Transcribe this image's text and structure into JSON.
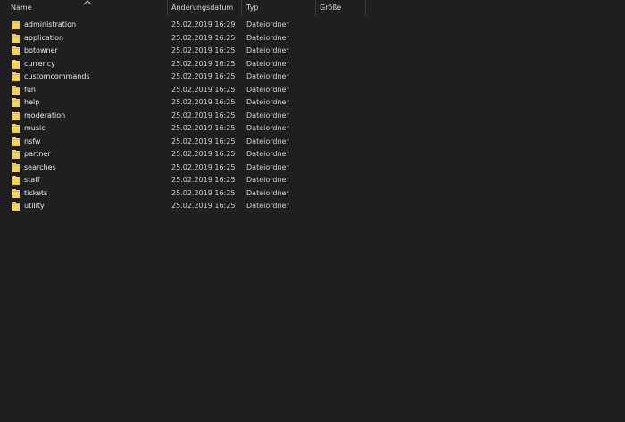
{
  "columns": {
    "name": "Name",
    "date": "Änderungsdatum",
    "type": "Typ",
    "size": "Größe"
  },
  "sort": {
    "column": "name",
    "direction": "ascending",
    "icon": "chevron-up-icon"
  },
  "colors": {
    "background": "#1f1f1f",
    "folder": "#f3d061",
    "text": "#e8e8e8"
  },
  "files": [
    {
      "name": "administration",
      "date": "25.02.2019 16:29",
      "type": "Dateiordner",
      "size": "",
      "icon": "folder-icon"
    },
    {
      "name": "application",
      "date": "25.02.2019 16:25",
      "type": "Dateiordner",
      "size": "",
      "icon": "folder-icon"
    },
    {
      "name": "botowner",
      "date": "25.02.2019 16:25",
      "type": "Dateiordner",
      "size": "",
      "icon": "folder-icon"
    },
    {
      "name": "currency",
      "date": "25.02.2019 16:25",
      "type": "Dateiordner",
      "size": "",
      "icon": "folder-icon"
    },
    {
      "name": "customcommands",
      "date": "25.02.2019 16:25",
      "type": "Dateiordner",
      "size": "",
      "icon": "folder-icon"
    },
    {
      "name": "fun",
      "date": "25.02.2019 16:25",
      "type": "Dateiordner",
      "size": "",
      "icon": "folder-icon"
    },
    {
      "name": "help",
      "date": "25.02.2019 16:25",
      "type": "Dateiordner",
      "size": "",
      "icon": "folder-icon"
    },
    {
      "name": "moderation",
      "date": "25.02.2019 16:25",
      "type": "Dateiordner",
      "size": "",
      "icon": "folder-icon"
    },
    {
      "name": "music",
      "date": "25.02.2019 16:25",
      "type": "Dateiordner",
      "size": "",
      "icon": "folder-icon"
    },
    {
      "name": "nsfw",
      "date": "25.02.2019 16:25",
      "type": "Dateiordner",
      "size": "",
      "icon": "folder-icon"
    },
    {
      "name": "partner",
      "date": "25.02.2019 16:25",
      "type": "Dateiordner",
      "size": "",
      "icon": "folder-icon"
    },
    {
      "name": "searches",
      "date": "25.02.2019 16:25",
      "type": "Dateiordner",
      "size": "",
      "icon": "folder-icon"
    },
    {
      "name": "staff",
      "date": "25.02.2019 16:25",
      "type": "Dateiordner",
      "size": "",
      "icon": "folder-icon"
    },
    {
      "name": "tickets",
      "date": "25.02.2019 16:25",
      "type": "Dateiordner",
      "size": "",
      "icon": "folder-icon"
    },
    {
      "name": "utility",
      "date": "25.02.2019 16:25",
      "type": "Dateiordner",
      "size": "",
      "icon": "folder-icon"
    }
  ]
}
